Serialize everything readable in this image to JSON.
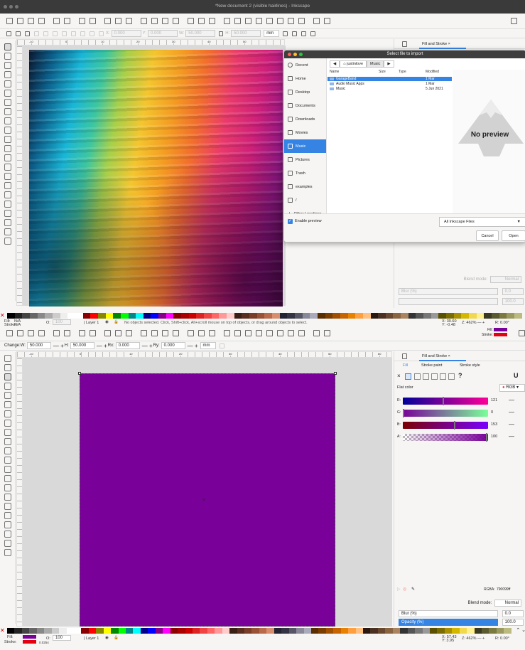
{
  "window": {
    "title": "*New document 2 (visible hairlines) - Inkscape"
  },
  "toolbar_top": {
    "x_label": "X:",
    "x_value": "0.000",
    "y_label": "Y:",
    "y_value": "0.000",
    "w_label": "W:",
    "w_value": "50.000",
    "h_label": "H:",
    "h_value": "50.000",
    "unit": "mm"
  },
  "tool_controls": {
    "change_label": "Change:",
    "w_label": "W:",
    "w_value": "50.000",
    "h_label": "H:",
    "h_value": "50.000",
    "rx_label": "Rx:",
    "rx_value": "0.000",
    "ry_label": "Ry:",
    "ry_value": "0.000",
    "unit": "mm"
  },
  "ruler_top_ticks": [
    "-10",
    "0",
    "10",
    "20",
    "30",
    "40",
    "50",
    "60"
  ],
  "dialog": {
    "title": "Select file to import",
    "places": [
      {
        "label": "Recent",
        "icon": "clock-icon"
      },
      {
        "label": "Home",
        "icon": "home-icon"
      },
      {
        "label": "Desktop",
        "icon": "folder-icon"
      },
      {
        "label": "Documents",
        "icon": "document-icon"
      },
      {
        "label": "Downloads",
        "icon": "download-icon"
      },
      {
        "label": "Movies",
        "icon": "movie-icon"
      },
      {
        "label": "Music",
        "icon": "music-icon",
        "selected": true
      },
      {
        "label": "Pictures",
        "icon": "picture-icon"
      },
      {
        "label": "Trash",
        "icon": "trash-icon"
      },
      {
        "label": "examples",
        "icon": "folder-icon"
      },
      {
        "label": "/",
        "icon": "drive-icon"
      },
      {
        "label": "Other Locations",
        "icon": "plus-icon"
      }
    ],
    "path": [
      "justinlove",
      "Music"
    ],
    "columns": {
      "name": "Name",
      "size": "Size",
      "type": "Type",
      "modified": "Modified"
    },
    "files": [
      {
        "name": "GarageBand",
        "size": "",
        "type": "",
        "modified": "1 Mar",
        "selected": true
      },
      {
        "name": "Audio Music Apps",
        "size": "",
        "type": "",
        "modified": "1 Mar"
      },
      {
        "name": "Music",
        "size": "",
        "type": "",
        "modified": "5 Jun 2021"
      }
    ],
    "preview_text": "No preview",
    "enable_preview": "Enable preview",
    "filter": "All Inkscape Files",
    "cancel": "Cancel",
    "open": "Open"
  },
  "panel_top": {
    "tab": "Fill and Stroke",
    "blend_label": "Blend mode:",
    "blend_value": "Normal",
    "blur_label": "Blur (%)",
    "blur_value": "0.0",
    "opacity_value": "100.0"
  },
  "status_top": {
    "fill_label": "Fill:",
    "fill_value": "N/A",
    "stroke_label": "Stroke:",
    "stroke_value": "N/A",
    "o_label": "O:",
    "o_value": "100",
    "layer": "Layer 1",
    "message": "No objects selected. Click, Shift+click, Alt+scroll mouse on top of objects, or drag around objects to select.",
    "x": "30.60",
    "y": "-0.48",
    "zoom": "462%",
    "rotation": "0.00°"
  },
  "panel_bottom": {
    "tab": "Fill and Stroke",
    "subtabs": [
      "Fill",
      "Stroke paint",
      "Stroke style"
    ],
    "flat_color": "Flat color",
    "mode": "RGB",
    "channels": [
      {
        "label": "R:",
        "value": "121"
      },
      {
        "label": "G:",
        "value": "0"
      },
      {
        "label": "B:",
        "value": "153"
      },
      {
        "label": "A:",
        "value": "100"
      }
    ],
    "rgba_label": "RGBA:",
    "rgba_value": "790099ff",
    "blend_label": "Blend mode:",
    "blend_value": "Normal",
    "blur_label": "Blur (%)",
    "blur_value": "0.0",
    "opacity_label": "Opacity (%)",
    "opacity_value": "100.0"
  },
  "status_bottom": {
    "fill_label": "Fill:",
    "stroke_label": "Stroke:",
    "stroke_width": "0.0254",
    "o_label": "O:",
    "o_value": "100",
    "layer": "Layer 1",
    "x": "57.43",
    "y": "3.95",
    "zoom": "462%",
    "rotation": "0.00°"
  },
  "colors": {
    "fill": "#790099",
    "stroke": "#e3000f",
    "accent": "#3584e4"
  }
}
